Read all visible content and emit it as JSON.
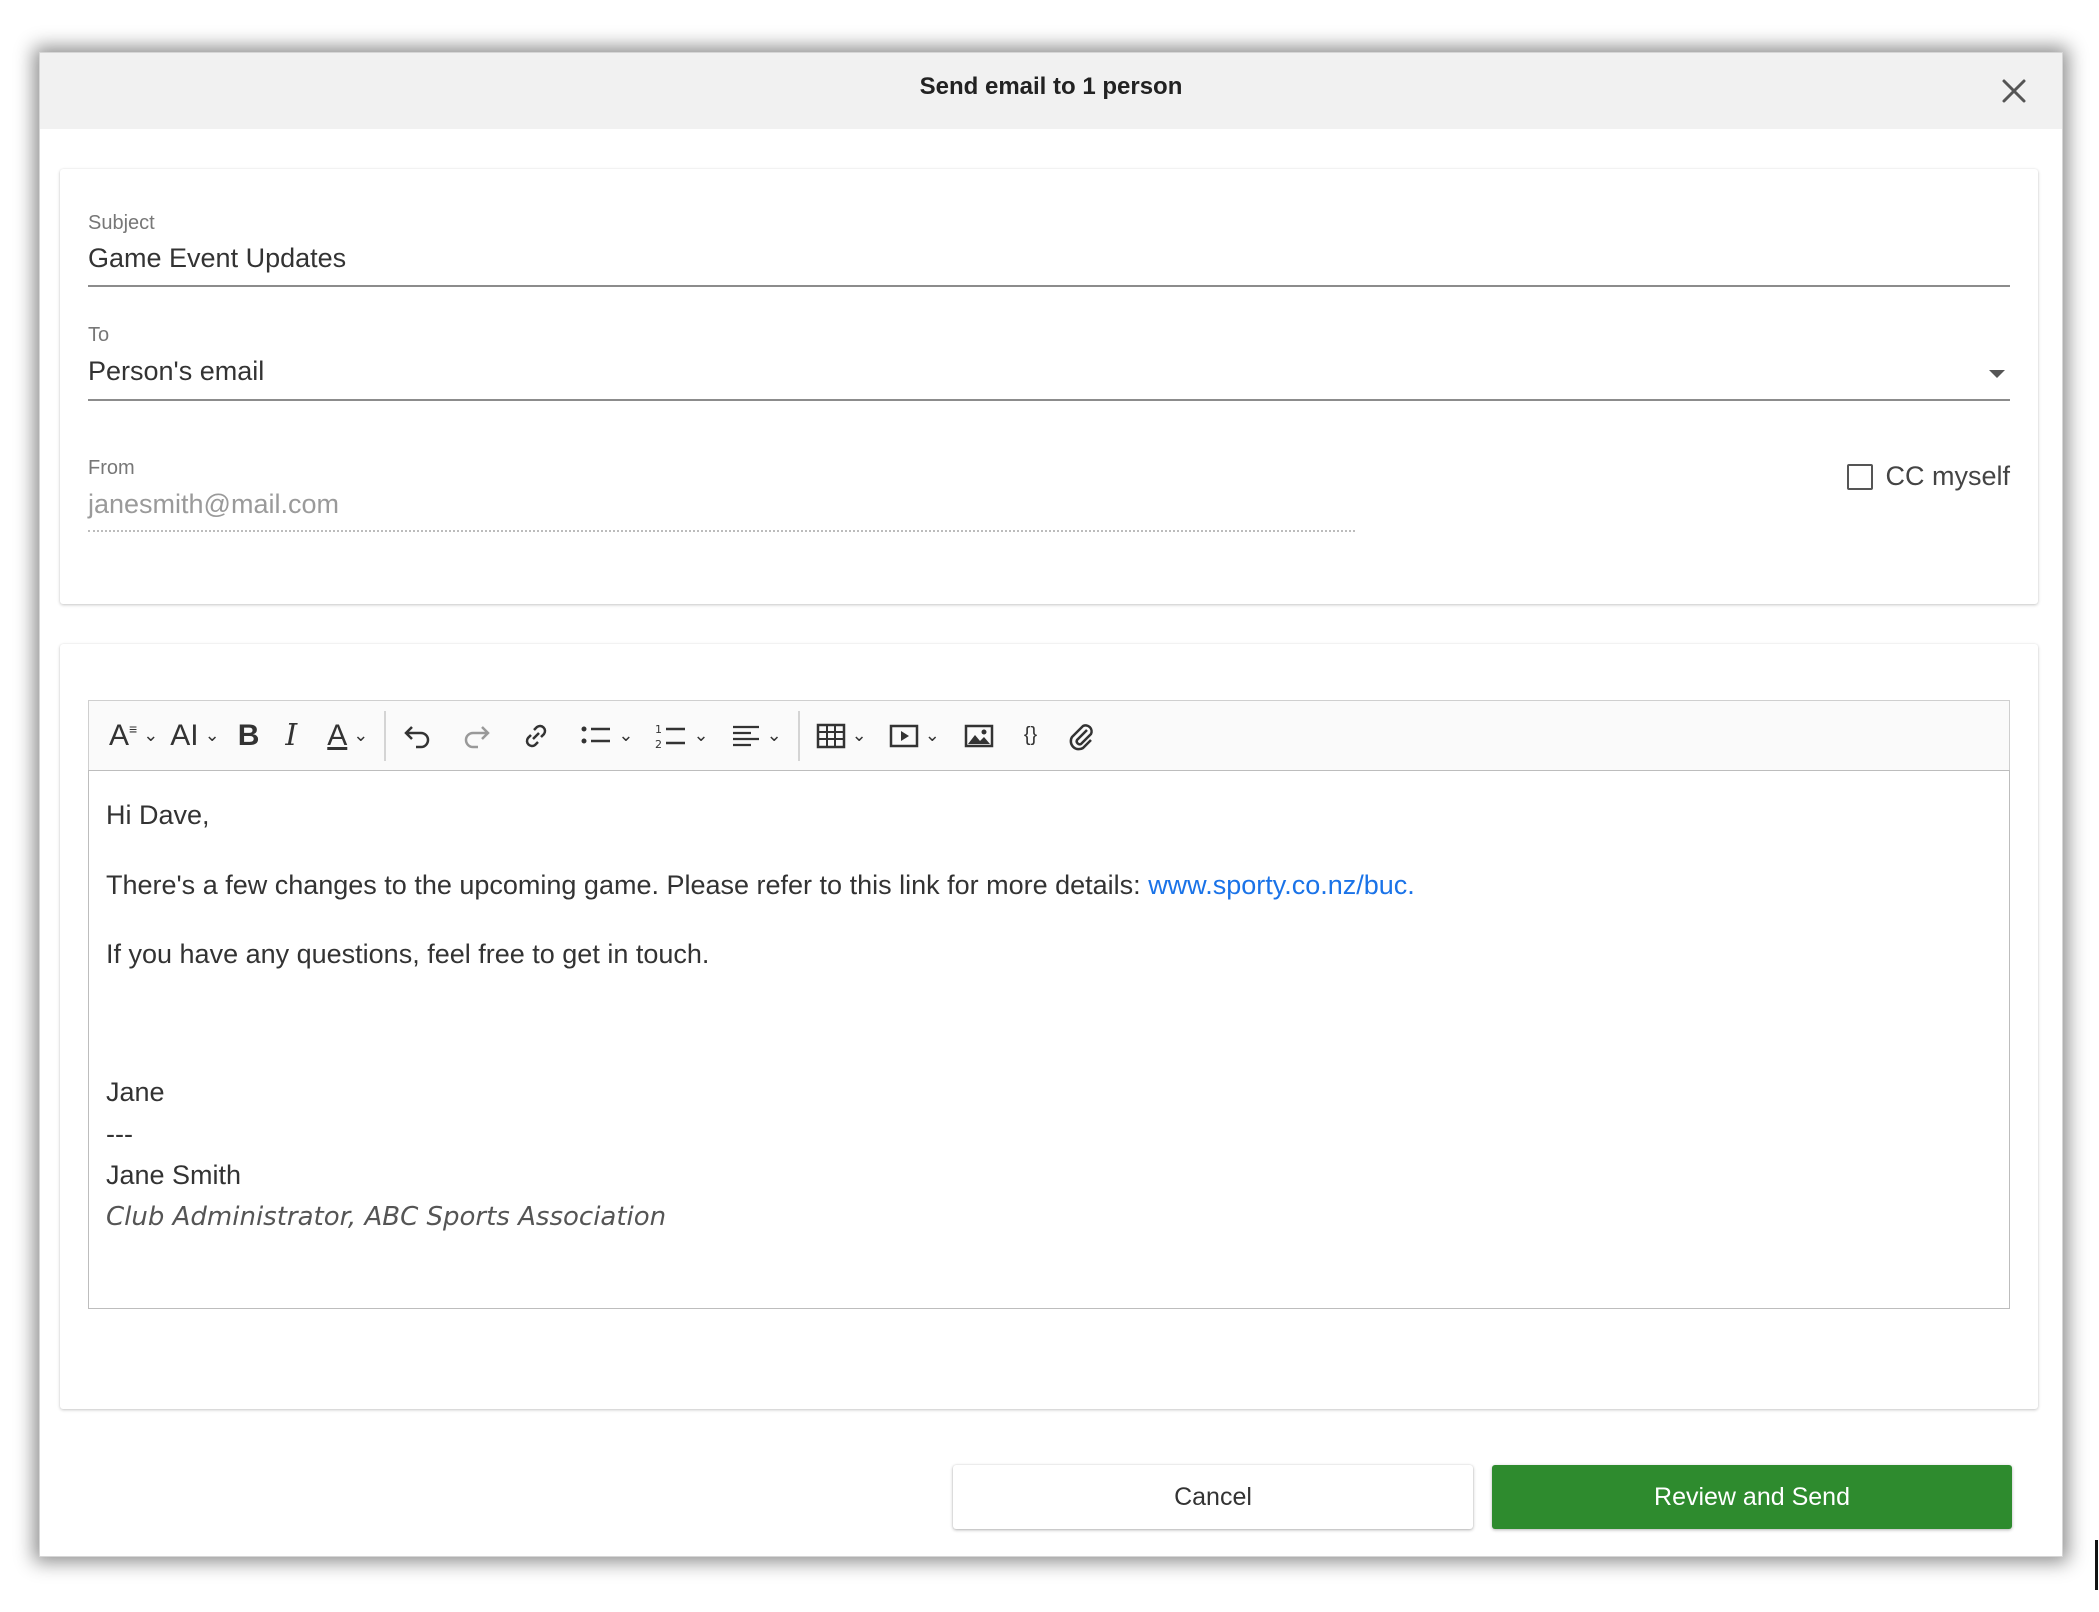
{
  "dialog": {
    "title": "Send email to 1 person",
    "close_icon": "close-icon"
  },
  "fields": {
    "subject": {
      "label": "Subject",
      "value": "Game Event Updates"
    },
    "to": {
      "label": "To",
      "value": "Person's email",
      "icon": "caret-down-icon"
    },
    "from": {
      "label": "From",
      "value": "janesmith@mail.com"
    },
    "cc": {
      "label": "CC myself",
      "checked": false
    }
  },
  "toolbar": {
    "items": [
      "font-family-icon",
      "font-size-icon",
      "bold-icon",
      "italic-icon",
      "text-color-icon",
      "undo-icon",
      "redo-icon",
      "link-icon",
      "bullet-list-icon",
      "numbered-list-icon",
      "align-icon",
      "table-icon",
      "media-icon",
      "image-icon",
      "code-icon",
      "attachment-icon"
    ],
    "labels": {
      "font_size": "AI",
      "bold": "B",
      "italic": "I",
      "text_color": "A",
      "code": "{}"
    }
  },
  "body": {
    "greeting": "Hi Dave,",
    "line1_text": "There's a few changes to the upcoming game. Please refer to this link for more details: ",
    "line1_link": "www.sporty.co.nz/buc.",
    "line2": "If you have any questions, feel free to get in touch.",
    "sign_name": "Jane",
    "sig_separator": "---",
    "sig_full_name": "Jane Smith",
    "sig_title": "Club Administrator, ABC Sports Association"
  },
  "buttons": {
    "cancel": "Cancel",
    "review_send": "Review and Send"
  },
  "colors": {
    "accent_green": "#2e8b2e",
    "link_blue": "#1a73e8",
    "title_bar": "#f1f1f1"
  }
}
